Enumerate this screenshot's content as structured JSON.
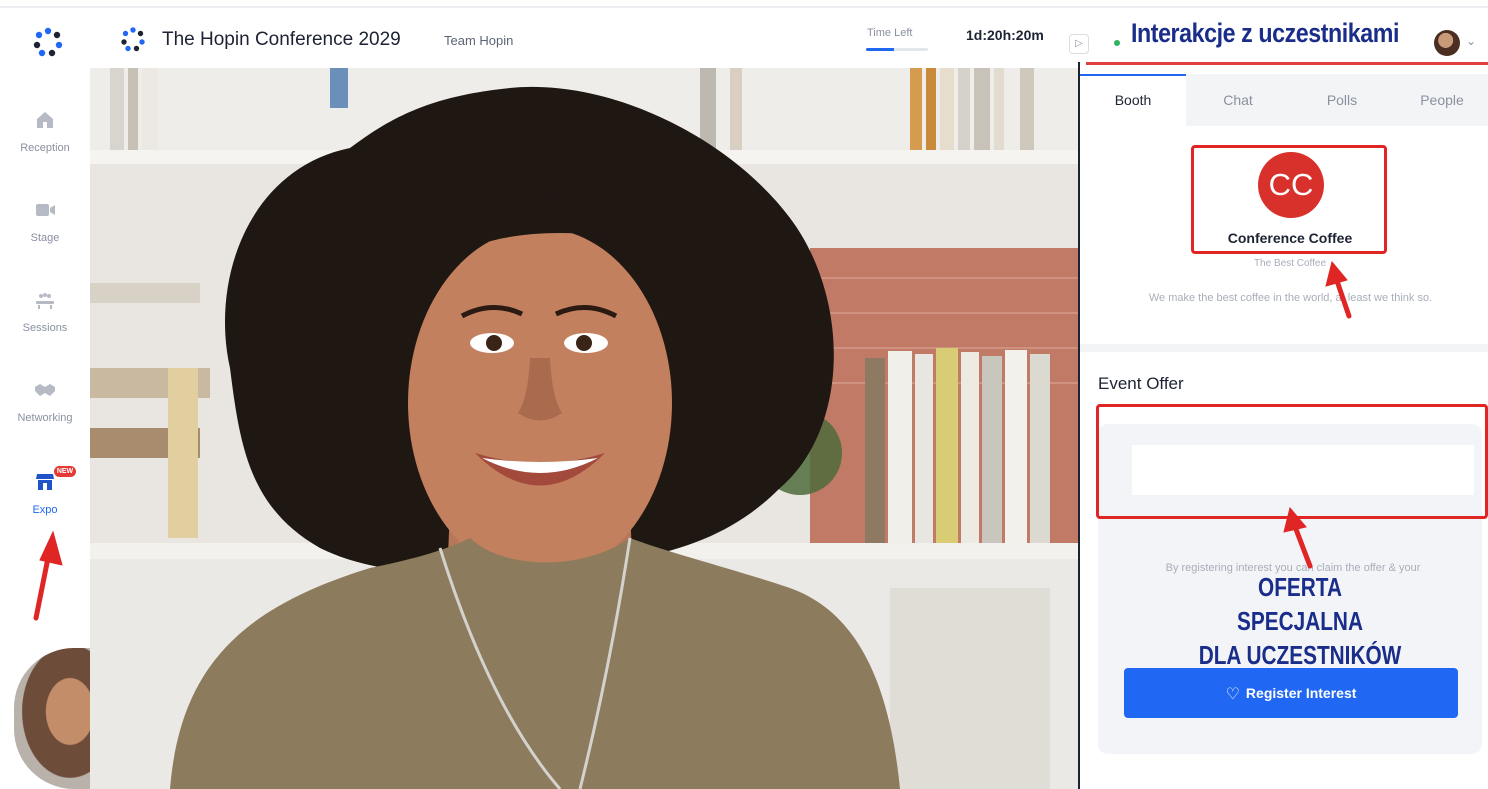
{
  "header": {
    "event_title": "The Hopin Conference 2029",
    "team_name": "Team Hopin",
    "time_left_label": "Time Left",
    "time_left_value": "1d:20h:20m",
    "time_progress_fraction": 0.45,
    "collapse_label": "▷",
    "overlay_heading": "Interakcje z uczestnikami",
    "chevron": "⌄"
  },
  "sidebar": {
    "items": [
      {
        "label": "Reception",
        "icon": "home-icon"
      },
      {
        "label": "Stage",
        "icon": "video-camera-icon"
      },
      {
        "label": "Sessions",
        "icon": "sessions-icon"
      },
      {
        "label": "Networking",
        "icon": "handshake-icon"
      },
      {
        "label": "Expo",
        "icon": "booth-icon",
        "badge": "NEW",
        "active": true
      }
    ]
  },
  "panel": {
    "tabs": [
      {
        "label": "Booth",
        "active": true
      },
      {
        "label": "Chat"
      },
      {
        "label": "Polls"
      },
      {
        "label": "People"
      }
    ],
    "booth": {
      "logo_text": "CC",
      "name": "Conference Coffee",
      "tagline": "The Best Coffee",
      "description": "We make the best coffee in the world, at least we think so."
    },
    "offer": {
      "title": "Event Offer",
      "note": "By registering interest you can claim the offer & your",
      "overlay_line1": "OFERTA SPECJALNA",
      "overlay_line2": "DLA UCZESTNIKÓW",
      "button_label": "Register Interest"
    }
  },
  "colors": {
    "accent": "#2068f3",
    "brand_red": "#d8312b",
    "annotation_red": "#e02525",
    "overlay_text": "#1a2d8a"
  }
}
